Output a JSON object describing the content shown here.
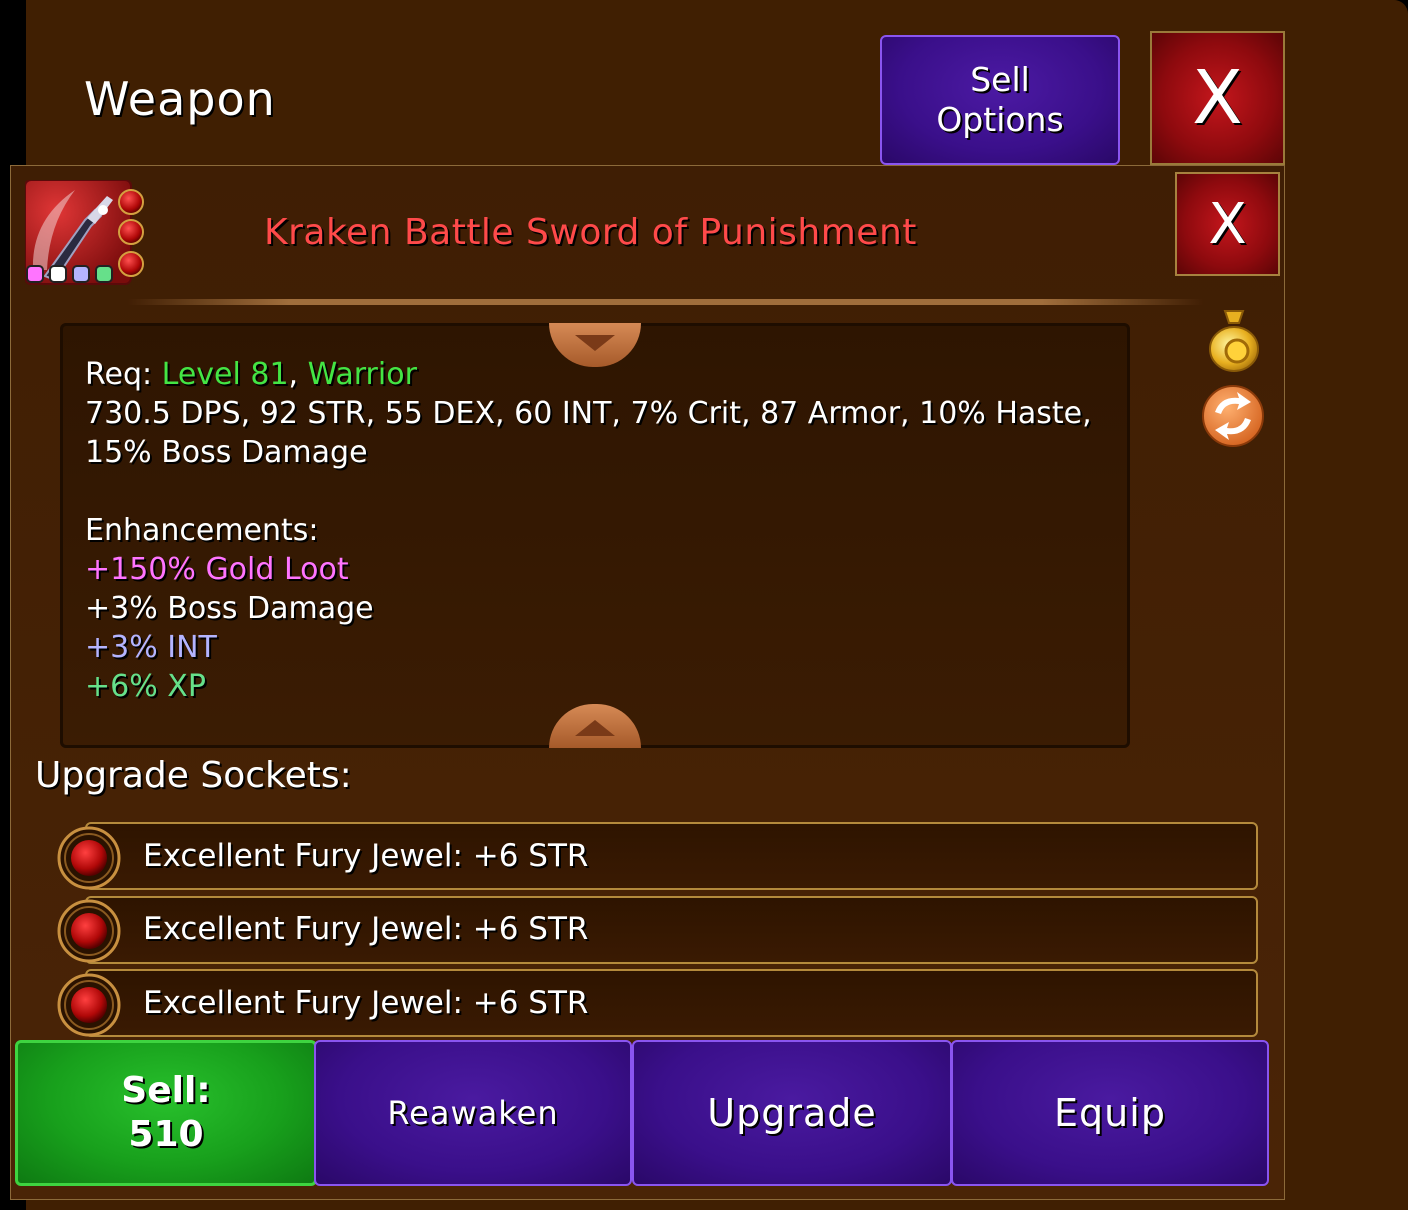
{
  "window": {
    "title": "Weapon",
    "sell_options_line1": "Sell",
    "sell_options_line2": "Options",
    "close_label": "X"
  },
  "item": {
    "name": "Kraken Battle Sword of Punishment",
    "name_color": "#ff4a4a",
    "close_label": "X",
    "icon": "sword-icon",
    "socket_gem_count": 3,
    "enhancement_dot_colors": [
      "#ff74ff",
      "#ffffff",
      "#b4b4ff",
      "#66e08a"
    ]
  },
  "details": {
    "req_label": "Req: ",
    "req_level": "Level 81",
    "req_separator": ", ",
    "req_class": "Warrior",
    "stats_line1": "730.5 DPS, 92 STR, 55 DEX, 60 INT, 7% Crit, 87 Armor, 10% Haste,",
    "stats_line2": "15% Boss Damage",
    "enhancements_title": "Enhancements:",
    "enhancements": [
      {
        "text": "+150% Gold Loot",
        "color": "#ff74ff"
      },
      {
        "text": "+3% Boss Damage",
        "color": "#ffffff"
      },
      {
        "text": "+3% INT",
        "color": "#b4b4ff"
      },
      {
        "text": "+6% XP",
        "color": "#66e08a"
      }
    ]
  },
  "side_icons": [
    "gold-bag-icon",
    "refresh-icon"
  ],
  "upgrade_sockets": {
    "title": "Upgrade Sockets:",
    "items": [
      {
        "text": "Excellent Fury Jewel: +6 STR",
        "icon": "red-gem-icon"
      },
      {
        "text": "Excellent Fury Jewel: +6 STR",
        "icon": "red-gem-icon"
      },
      {
        "text": "Excellent Fury Jewel: +6 STR",
        "icon": "red-gem-icon"
      }
    ]
  },
  "actions": {
    "sell_label": "Sell:",
    "sell_value": "510",
    "reawaken": "Reawaken",
    "upgrade": "Upgrade",
    "equip": "Equip"
  }
}
